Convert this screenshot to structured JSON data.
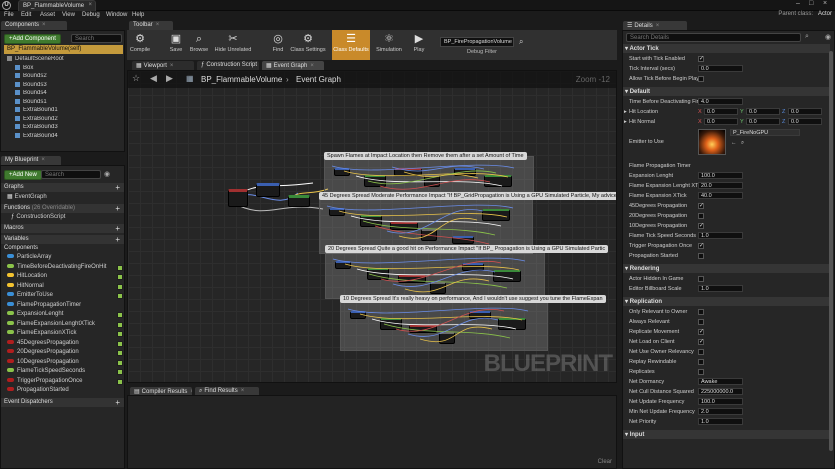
{
  "window": {
    "doc_tab": "BP_FlammableVolume",
    "parent_class_label": "Parent class:",
    "parent_class_value": "Actor"
  },
  "menu": [
    "File",
    "Edit",
    "Asset",
    "View",
    "Debug",
    "Window",
    "Help"
  ],
  "components_panel": {
    "tab": "Components",
    "add_button": "+Add Component",
    "search_placeholder": "Search",
    "self_item": "BP_FlammableVolume(self)",
    "tree": [
      "DefaultSceneRoot",
      "Box",
      "Bounds2",
      "Bounds3",
      "Bounds4",
      "Bounds1",
      "ExtraBound1",
      "ExtraBound2",
      "ExtraBound3",
      "ExtraBound4"
    ]
  },
  "my_blueprint": {
    "tab": "My Blueprint",
    "add_button": "+Add New",
    "search_placeholder": "Search",
    "graphs_label": "Graphs",
    "event_graph": "EventGraph",
    "functions_label": "Functions",
    "functions_overridable": "(26 Overridable)",
    "construction_script": "ConstructionScript",
    "macros_label": "Macros",
    "variables_label": "Variables",
    "components_label": "Components",
    "event_dispatchers_label": "Event Dispatchers",
    "variables": [
      {
        "name": "ParticleArray",
        "color": "#3a8fd6",
        "eye": false
      },
      {
        "name": "TimeBeforeDeactivatingFireOnHit",
        "color": "#8bc34a",
        "eye": true
      },
      {
        "name": "HitLocation",
        "color": "#f2c230",
        "eye": true
      },
      {
        "name": "HitNormal",
        "color": "#f2c230",
        "eye": true
      },
      {
        "name": "EmitterToUse",
        "color": "#3a8fd6",
        "eye": true
      },
      {
        "name": "FlamePropagationTimer",
        "color": "#3a8fd6",
        "eye": false
      },
      {
        "name": "ExpansionLenght",
        "color": "#8bc34a",
        "eye": true
      },
      {
        "name": "FlameExpansionLenghtXTick",
        "color": "#8bc34a",
        "eye": true
      },
      {
        "name": "FlameExpansionXTick",
        "color": "#8bc34a",
        "eye": true
      },
      {
        "name": "45DegreesPropagation",
        "color": "#b01e1e",
        "eye": true
      },
      {
        "name": "20DegreesPropagation",
        "color": "#b01e1e",
        "eye": true
      },
      {
        "name": "10DegreesPropagation",
        "color": "#b01e1e",
        "eye": true
      },
      {
        "name": "FlameTickSpeedSeconds",
        "color": "#8bc34a",
        "eye": true
      },
      {
        "name": "TriggerPropagationOnce",
        "color": "#b01e1e",
        "eye": true
      },
      {
        "name": "PropagationStarted",
        "color": "#b01e1e",
        "eye": false
      }
    ]
  },
  "toolbar": {
    "tab": "Toolbar",
    "buttons": [
      {
        "label": "Compile",
        "icon": "compile-icon",
        "glyph": "⚙"
      },
      {
        "label": "Save",
        "icon": "save-icon",
        "glyph": "▣"
      },
      {
        "label": "Browse",
        "icon": "browse-icon",
        "glyph": "⌕"
      },
      {
        "label": "Hide Unrelated",
        "icon": "hide-unrelated-icon",
        "glyph": "✂"
      },
      {
        "label": "Find",
        "icon": "find-icon",
        "glyph": "◎"
      },
      {
        "label": "Class Settings",
        "icon": "class-settings-icon",
        "glyph": "⚙"
      },
      {
        "label": "Class Defaults",
        "icon": "class-defaults-icon",
        "glyph": "☰"
      },
      {
        "label": "Simulation",
        "icon": "simulation-icon",
        "glyph": "⚛"
      },
      {
        "label": "Play",
        "icon": "play-icon",
        "glyph": "▶"
      }
    ],
    "debug_object": "BP_FirePropagationVolume",
    "debug_filter": "Debug Filter"
  },
  "editor_tabs": [
    "Viewport",
    "Construction Script",
    "Event Graph"
  ],
  "graph": {
    "breadcrumb_root": "BP_FlammableVolume",
    "breadcrumb_leaf": "Event Graph",
    "zoom": "Zoom -12",
    "watermark": "BLUEPRINT",
    "comments": [
      "Spawn Flames at Impact Location then Remove them after a set Amount of Time",
      "45 Degrees Spread Moderate Performance Impact \"If BP_GridPropagation is Using a GPU Simulated Particle, My advice",
      "20 Degrees Spread Quite a good hit on Performance Impact \"If BP_     Propagation is Using a GPU Simulated Partic",
      "10 Degrees Spread It's really heavy on performance, And I wouldn't use      suggest you tune the FlameExpan"
    ]
  },
  "bottom_tabs": [
    "Compiler Results",
    "Find Results"
  ],
  "bottom_clear": "Clear",
  "details": {
    "tab": "Details",
    "search_placeholder": "Search Details",
    "sections": {
      "actor_tick": "Actor Tick",
      "default": "Default",
      "rendering": "Rendering",
      "replication": "Replication",
      "input": "Input"
    },
    "actor_tick": [
      {
        "label": "Start with Tick Enabled",
        "kind": "check",
        "checked": true
      },
      {
        "label": "Tick Interval (secs)",
        "kind": "num",
        "value": "0.0"
      },
      {
        "label": "Allow Tick Before Begin Play",
        "kind": "check",
        "checked": false
      }
    ],
    "default_top": [
      {
        "label": "Time Before Deactivating Fire",
        "value": "4.0"
      }
    ],
    "hit_location": {
      "label": "Hit Location",
      "x": "0.0",
      "y": "0.0",
      "z": "0.0"
    },
    "hit_normal": {
      "label": "Hit Normal",
      "x": "0.0",
      "y": "0.0",
      "z": "0.0"
    },
    "emitter": {
      "label": "Emitter to Use",
      "value": "P_FireNoGPU"
    },
    "timer": {
      "label": "Flame Propagation Timer"
    },
    "default_rest": [
      {
        "label": "Expansion Lenght",
        "kind": "num",
        "value": "100.0"
      },
      {
        "label": "Flame Expansion Lenght XTick",
        "kind": "num",
        "value": "20.0"
      },
      {
        "label": "Flame Expansion XTick",
        "kind": "num",
        "value": "40.0"
      },
      {
        "label": "45Degrees Propagation",
        "kind": "check",
        "checked": true
      },
      {
        "label": "20Degrees Propagation",
        "kind": "check",
        "checked": false
      },
      {
        "label": "10Degrees Propagation",
        "kind": "check",
        "checked": true
      },
      {
        "label": "Flame Tick Speed Seconds",
        "kind": "num",
        "value": "1.0"
      },
      {
        "label": "Trigger Propagation Once",
        "kind": "check",
        "checked": true
      },
      {
        "label": "Propagation Started",
        "kind": "check",
        "checked": false
      }
    ],
    "rendering": [
      {
        "label": "Actor Hidden In Game",
        "kind": "check",
        "checked": false
      },
      {
        "label": "Editor Billboard Scale",
        "kind": "num",
        "value": "1.0"
      }
    ],
    "replication": [
      {
        "label": "Only Relevant to Owner",
        "kind": "check",
        "checked": false
      },
      {
        "label": "Always Relevant",
        "kind": "check",
        "checked": false
      },
      {
        "label": "Replicate Movement",
        "kind": "check",
        "checked": true
      },
      {
        "label": "Net Load on Client",
        "kind": "check",
        "checked": true
      },
      {
        "label": "Net Use Owner Relevancy",
        "kind": "check",
        "checked": false
      },
      {
        "label": "Replay Rewindable",
        "kind": "check",
        "checked": false
      },
      {
        "label": "Replicates",
        "kind": "check",
        "checked": false
      },
      {
        "label": "Net Dormancy",
        "kind": "num",
        "value": "Awake"
      },
      {
        "label": "Net Cull Distance Squared",
        "kind": "num",
        "value": "225000000.0"
      },
      {
        "label": "Net Update Frequency",
        "kind": "num",
        "value": "100.0"
      },
      {
        "label": "Min Net Update Frequency",
        "kind": "num",
        "value": "2.0"
      },
      {
        "label": "Net Priority",
        "kind": "num",
        "value": "1.0"
      }
    ]
  }
}
